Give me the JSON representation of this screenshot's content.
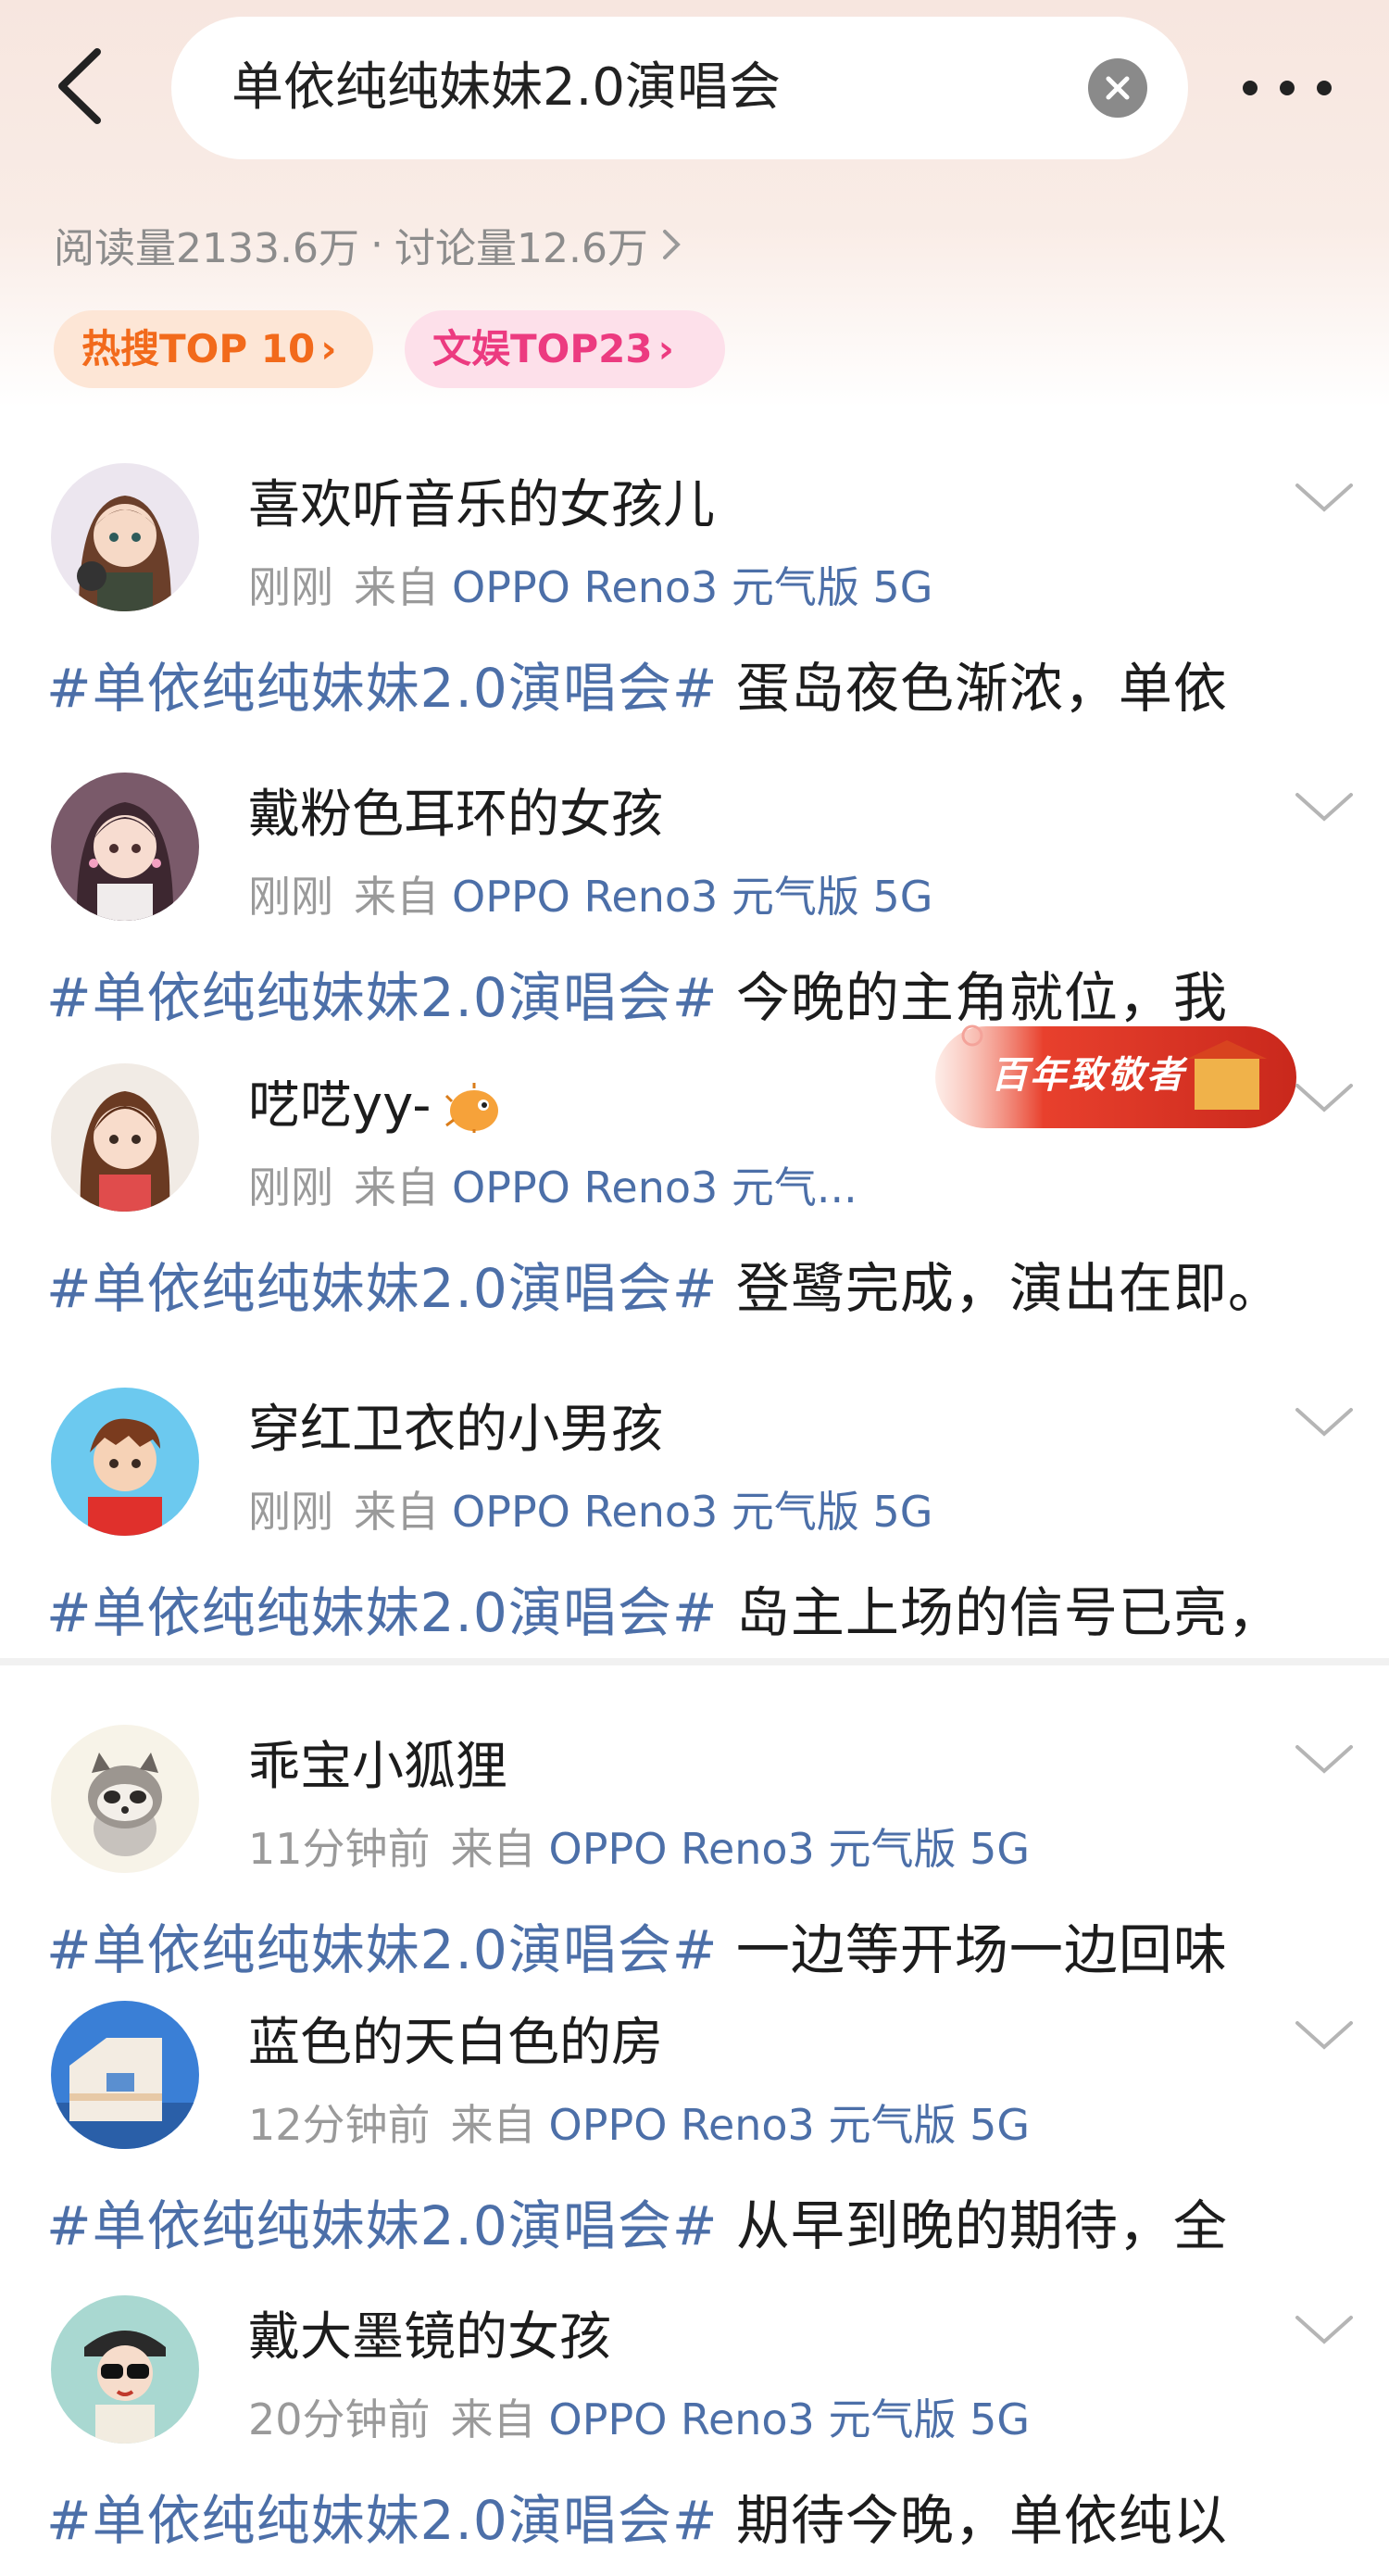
{
  "header": {
    "search_query": "单依纯纯妹妹2.0演唱会",
    "stats": {
      "reads": "阅读量2133.6万",
      "separator": "·",
      "discussions": "讨论量12.6万"
    },
    "tags": [
      {
        "label": "热搜TOP 10",
        "color": "#f26a1b"
      },
      {
        "label": "文娱TOP23",
        "color": "#ec3b80"
      }
    ]
  },
  "banner": {
    "label": "百年致敬者"
  },
  "posts": [
    {
      "user": "喜欢听音乐的女孩儿",
      "time": "刚刚",
      "from": "来自",
      "device": "OPPO Reno3 元气版 5G",
      "hashtag": "#单依纯纯妹妹2.0演唱会#",
      "text": "蛋岛夜色渐浓，单依"
    },
    {
      "user": "戴粉色耳环的女孩",
      "time": "刚刚",
      "from": "来自",
      "device": "OPPO Reno3 元气版 5G",
      "hashtag": "#单依纯纯妹妹2.0演唱会#",
      "text": "今晚的主角就位，我"
    },
    {
      "user": "呓呓yy-",
      "time": "刚刚",
      "from": "来自",
      "device": "OPPO Reno3 元气...",
      "hashtag": "#单依纯纯妹妹2.0演唱会#",
      "text": "登鹭完成，演出在即。"
    },
    {
      "user": "穿红卫衣的小男孩",
      "time": "刚刚",
      "from": "来自",
      "device": "OPPO Reno3 元气版 5G",
      "hashtag": "#单依纯纯妹妹2.0演唱会#",
      "text": "岛主上场的信号已亮，"
    },
    {
      "user": "乖宝小狐狸",
      "time": "11分钟前",
      "from": "来自",
      "device": "OPPO Reno3 元气版 5G",
      "hashtag": "#单依纯纯妹妹2.0演唱会#",
      "text": "一边等开场一边回味"
    },
    {
      "user": "蓝色的天白色的房",
      "time": "12分钟前",
      "from": "来自",
      "device": "OPPO Reno3 元气版 5G",
      "hashtag": "#单依纯纯妹妹2.0演唱会#",
      "text": "从早到晚的期待，全"
    },
    {
      "user": "戴大墨镜的女孩",
      "time": "20分钟前",
      "from": "来自",
      "device": "OPPO Reno3 元气版 5G",
      "hashtag": "#单依纯纯妹妹2.0演唱会#",
      "text": "期待今晚，单依纯以"
    }
  ]
}
